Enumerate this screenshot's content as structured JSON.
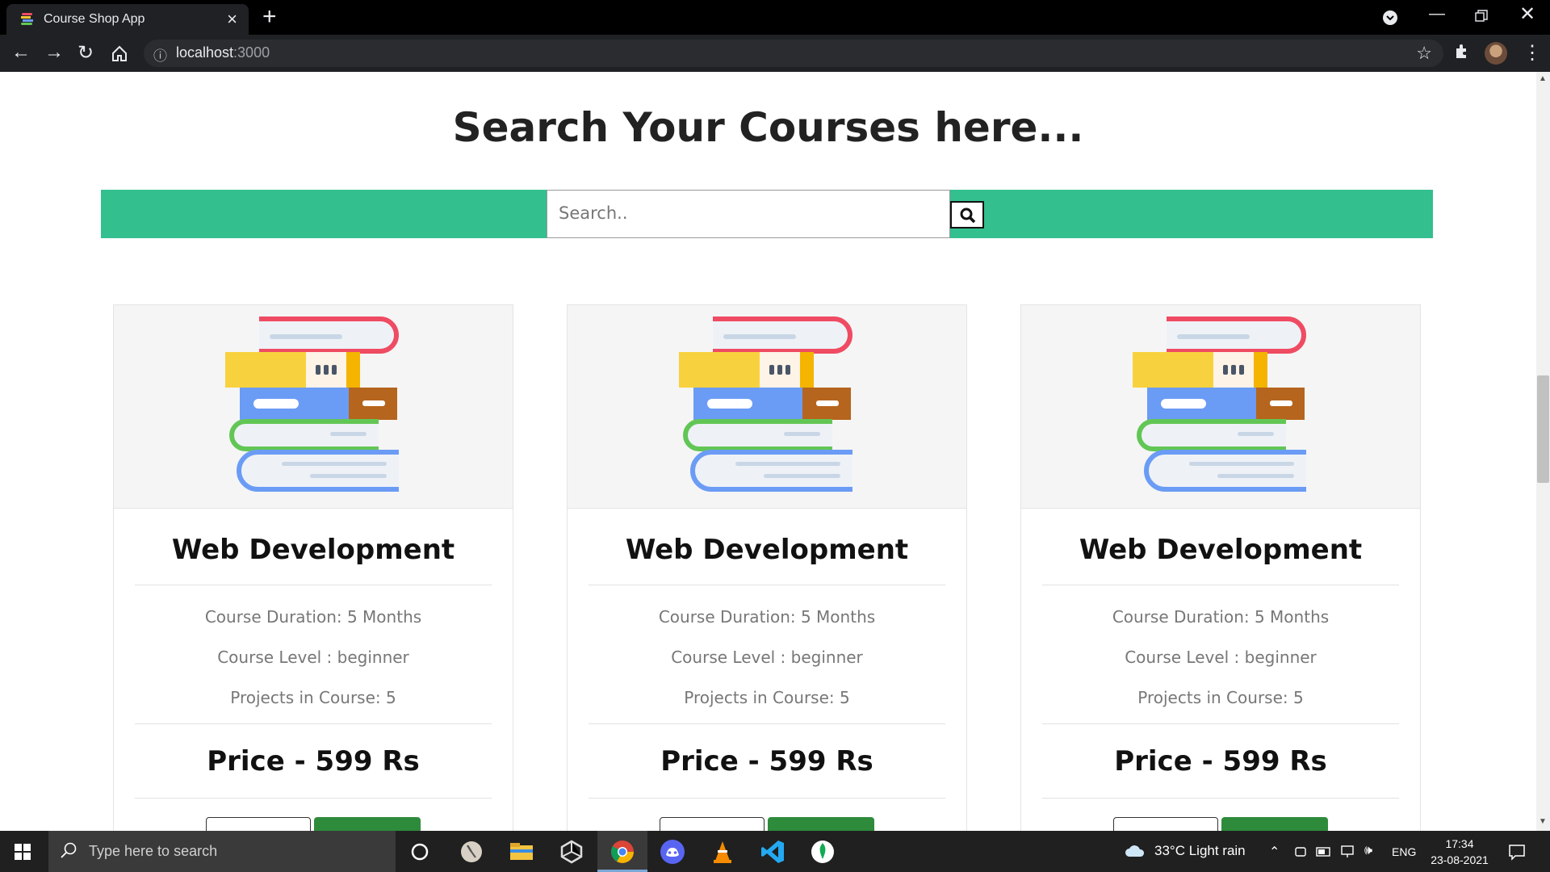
{
  "browser": {
    "tab_title": "Course Shop App",
    "url_host": "localhost",
    "url_port": ":3000"
  },
  "page": {
    "heading": "Search Your Courses here...",
    "search_placeholder": "Search..",
    "accent_color": "#33bf8e",
    "cards": [
      {
        "title": "Web Development",
        "duration": "Course Duration: 5 Months",
        "level": "Course Level : beginner",
        "projects": "Projects in Course: 5",
        "price": "Price - 599 Rs"
      },
      {
        "title": "Web Development",
        "duration": "Course Duration: 5 Months",
        "level": "Course Level : beginner",
        "projects": "Projects in Course: 5",
        "price": "Price - 599 Rs"
      },
      {
        "title": "Web Development",
        "duration": "Course Duration: 5 Months",
        "level": "Course Level : beginner",
        "projects": "Projects in Course: 5",
        "price": "Price - 599 Rs"
      }
    ]
  },
  "taskbar": {
    "search_placeholder": "Type here to search",
    "weather": "33°C  Light rain",
    "language": "ENG",
    "time": "17:34",
    "date": "23-08-2021"
  }
}
